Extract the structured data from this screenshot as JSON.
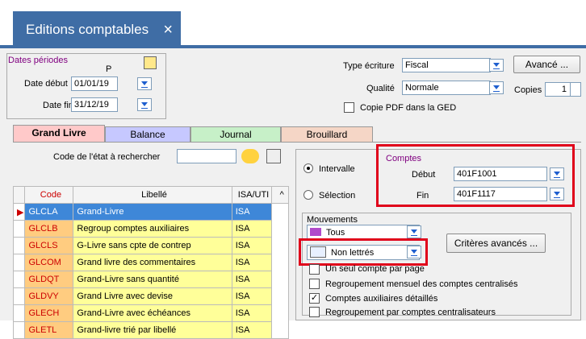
{
  "window": {
    "title": "Editions comptables",
    "close": "×"
  },
  "periods": {
    "group_label": "Dates périodes",
    "code": "P",
    "start_label": "Date début",
    "start_value": "01/01/19",
    "end_label": "Date fin",
    "end_value": "31/12/19"
  },
  "options": {
    "type_label": "Type écriture",
    "type_value": "Fiscal",
    "advanced_button": "Avancé ...",
    "quality_label": "Qualité",
    "quality_value": "Normale",
    "copies_label": "Copies",
    "copies_value": "1",
    "pdf_label": "Copie PDF dans la GED"
  },
  "tabs": [
    {
      "label": "Grand Livre",
      "color": "#ffc9c9"
    },
    {
      "label": "Balance",
      "color": "#c6c8ff"
    },
    {
      "label": "Journal",
      "color": "#c7f0c8"
    },
    {
      "label": "Brouillard",
      "color": "#f5d6c6"
    }
  ],
  "search": {
    "label": "Code de l'état à rechercher",
    "value": ""
  },
  "grid": {
    "headers": [
      "Code",
      "Libellé",
      "ISA/UTI"
    ],
    "rows": [
      {
        "code": "GLCLA",
        "label": "Grand-Livre",
        "type": "ISA"
      },
      {
        "code": "GLCLB",
        "label": "Regroup comptes auxiliaires",
        "type": "ISA"
      },
      {
        "code": "GLCLS",
        "label": "G-Livre sans cpte de contrep",
        "type": "ISA"
      },
      {
        "code": "GLCOM",
        "label": "Grand livre des commentaires",
        "type": "ISA"
      },
      {
        "code": "GLDQT",
        "label": "Grand-Livre sans quantité",
        "type": "ISA"
      },
      {
        "code": "GLDVY",
        "label": "Grand Livre avec devise",
        "type": "ISA"
      },
      {
        "code": "GLECH",
        "label": "Grand-Livre avec échéances",
        "type": "ISA"
      },
      {
        "code": "GLETL",
        "label": "Grand-livre trié par libellé",
        "type": "ISA"
      }
    ]
  },
  "range": {
    "interval_label": "Intervalle",
    "selection_label": "Sélection",
    "accounts_title": "Comptes",
    "start_label": "Début",
    "start_value": "401F1001",
    "end_label": "Fin",
    "end_value": "401F1117"
  },
  "movements": {
    "title": "Mouvements",
    "all_value": "Tous",
    "letter_value": "Non lettrés",
    "criteria_button": "Critères avancés ...",
    "checks": [
      {
        "label": "Un seul compte par page",
        "checked": ""
      },
      {
        "label": "Regroupement mensuel des comptes centralisés",
        "checked": ""
      },
      {
        "label": "Comptes auxiliaires détaillés",
        "checked": "✓"
      },
      {
        "label": "Regroupement par comptes centralisateurs",
        "checked": ""
      }
    ]
  }
}
